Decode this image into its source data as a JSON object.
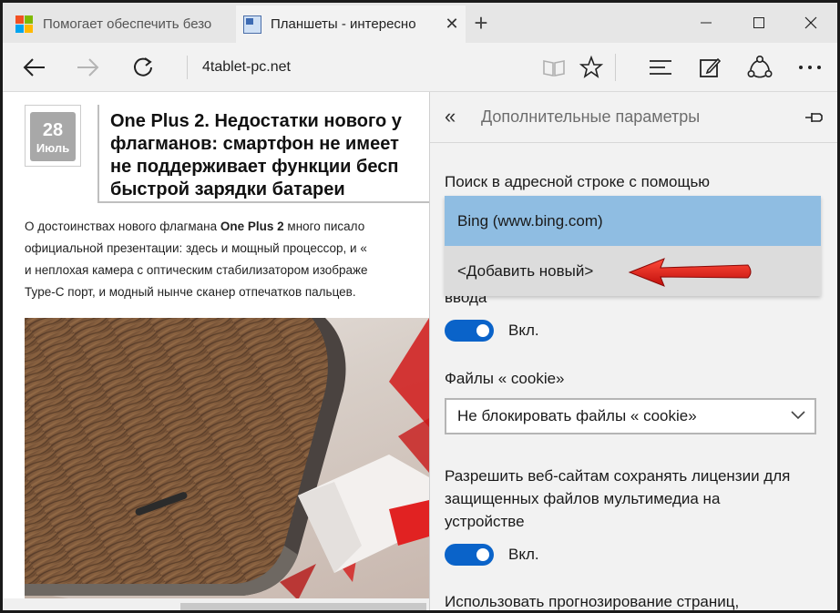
{
  "tabs": [
    {
      "label": "Помогает обеспечить безо",
      "icon": "microsoft-logo-icon"
    },
    {
      "label": "Планшеты - интересно",
      "icon": "site-favicon-icon",
      "close": "✕"
    }
  ],
  "new_tab": "+",
  "address": "4tablet-pc.net",
  "article": {
    "date_day": "28",
    "date_month": "Июль",
    "title_lines": [
      "One Plus 2. Недостатки нового у",
      "флагманов: смартфон не имеет",
      "не поддерживает функции бесп",
      "быстрой зарядки батареи"
    ],
    "body": {
      "line1_pre": "О достоинствах нового флагмана ",
      "line1_bold1": "One Plus 2",
      "line1_post": " много писало",
      "line2": "официальной презентации: здесь и мощный процессор, и «",
      "line3": "и неплохая камера с оптическим стабилизатором изображе",
      "line4": "Type-C порт, и модный нынче сканер отпечатков пальцев."
    }
  },
  "settings": {
    "title": "Дополнительные параметры",
    "search_label": "Поиск в адресной строке с помощью",
    "search_options": [
      "Bing (www.bing.com)",
      "<Добавить новый>"
    ],
    "partial_label": "ввода",
    "toggle1_label": "Вкл.",
    "cookies_label": "Файлы « cookie»",
    "cookies_value": "Не блокировать файлы « cookie»",
    "licenses_label_lines": [
      "Разрешить веб-сайтам сохранять лицензии для",
      "защищенных файлов мультимедиа на",
      "устройстве"
    ],
    "toggle2_label": "Вкл.",
    "prediction_label": "Использовать прогнозирование страниц,"
  },
  "colors": {
    "toggle_on": "#0a63c9",
    "selected_option": "#8fbde2",
    "arrow": "#e0201c"
  }
}
